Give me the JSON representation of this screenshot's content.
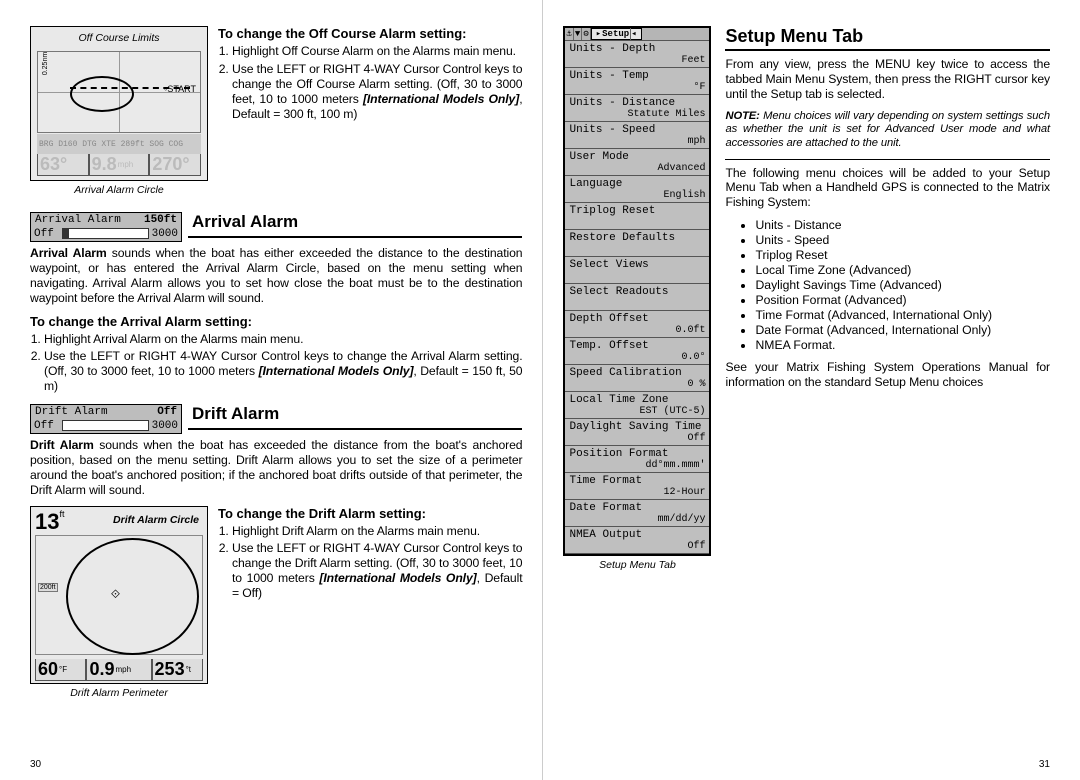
{
  "offcourse": {
    "label_top": "Off Course Limits",
    "label_bot": "Arrival Alarm Circle",
    "sub": "To change the Off Course Alarm setting:",
    "li1": "Highlight Off Course Alarm on the Alarms main  menu.",
    "li2_a": "Use the LEFT or RIGHT 4-WAY Cursor Control keys to change the Off Course Alarm setting. (Off, 30 to 3000 feet, 10 to 1000 meters ",
    "li2_b": "[International Models Only]",
    "li2_c": ", Default = 300 ft, 100 m)",
    "depthnum": "63°",
    "speed": "9.8",
    "trk": "270°"
  },
  "arrival": {
    "title": "Arrival Alarm",
    "wtop_l": "Arrival Alarm",
    "wtop_r": "150ft",
    "wbot_l": "Off",
    "wbot_r": "3000",
    "para_a": "Arrival Alarm",
    "para_b": " sounds when the boat has either exceeded the distance to the destination waypoint, or has entered the Arrival Alarm Circle, based on the menu setting when navigating.  Arrival Alarm allows you to set how close the boat must be to the destination waypoint before the Arrival Alarm will sound.",
    "sub": "To change the Arrival Alarm setting:",
    "li1": "Highlight Arrival Alarm on the Alarms main menu.",
    "li2_a": "Use the LEFT or RIGHT 4-WAY Cursor Control keys to change the Arrival Alarm setting. (Off, 30 to 3000 feet, 10 to 1000 meters ",
    "li2_b": "[International Models Only]",
    "li2_c": ", Default = 150 ft, 50 m)"
  },
  "drift": {
    "title": "Drift Alarm",
    "wtop_l": "Drift Alarm",
    "wtop_r": "Off",
    "wbot_l": "Off",
    "wbot_r": "3000",
    "para_a": "Drift Alarm",
    "para_b": " sounds when the boat has exceeded the distance from the boat's anchored position, based on the menu setting. Drift Alarm allows you to set the size of a perimeter around the boat's anchored position; if the anchored boat drifts outside of that perimeter, the Drift Alarm will sound.",
    "sub": "To change the Drift Alarm setting:",
    "li1": "Highlight Drift Alarm on the Alarms main menu.",
    "li2_a": "Use the LEFT or RIGHT 4-WAY Cursor Control keys to change the Drift Alarm setting. (Off, 30 to 3000 feet, 10 to 1000 meters ",
    "li2_b": "[International Models Only]",
    "li2_c": ", Default = Off)",
    "label_top": "Drift Alarm Circle",
    "label_bot": "Drift Alarm Perimeter",
    "depth": "13",
    "depth_u": "ft",
    "range": "200ft",
    "temp": "60",
    "speed": "0.9",
    "trk": "253"
  },
  "setup": {
    "title": "Setup Menu Tab",
    "caption": "Setup Menu Tab",
    "tab": "Setup",
    "rows": [
      {
        "k": "Units - Depth",
        "v": "Feet"
      },
      {
        "k": "Units - Temp",
        "v": "°F"
      },
      {
        "k": "Units - Distance",
        "v": "Statute Miles"
      },
      {
        "k": "Units - Speed",
        "v": "mph"
      },
      {
        "k": "User Mode",
        "v": "Advanced"
      },
      {
        "k": "Language",
        "v": "English"
      },
      {
        "k": "Triplog Reset",
        "v": ""
      },
      {
        "k": "Restore Defaults",
        "v": ""
      },
      {
        "k": "Select Views",
        "v": ""
      },
      {
        "k": "Select Readouts",
        "v": ""
      },
      {
        "k": "Depth Offset",
        "v": "0.0ft"
      },
      {
        "k": "Temp. Offset",
        "v": "0.0°"
      },
      {
        "k": "Speed Calibration",
        "v": "0 %"
      },
      {
        "k": "Local Time Zone",
        "v": "EST (UTC-5)"
      },
      {
        "k": "Daylight Saving Time",
        "v": "Off"
      },
      {
        "k": "Position Format",
        "v": "dd°mm.mmm'"
      },
      {
        "k": "Time Format",
        "v": "12-Hour"
      },
      {
        "k": "Date Format",
        "v": "mm/dd/yy"
      },
      {
        "k": "NMEA Output",
        "v": "Off"
      }
    ],
    "p1": "From any view, press the MENU key twice to access the tabbed Main Menu System, then press the RIGHT cursor key until the Setup tab is selected.",
    "note_lead": "NOTE:",
    "note": "  Menu choices will vary depending on system settings such as whether the unit is set for Advanced User mode and what accessories are attached to the unit.",
    "p2": "The following menu choices will be added to your Setup Menu Tab when a Handheld GPS is connected to the Matrix Fishing System:",
    "bullets": [
      "Units - Distance",
      "Units - Speed",
      "Triplog Reset",
      "Local Time Zone (Advanced)",
      "Daylight Savings Time (Advanced)",
      "Position Format (Advanced)",
      "Time Format (Advanced, International Only)",
      "Date Format (Advanced, International Only)",
      "NMEA Format."
    ],
    "p3": "See your Matrix Fishing System Operations Manual for information on the standard Setup Menu choices"
  },
  "pg_l": "30",
  "pg_r": "31"
}
